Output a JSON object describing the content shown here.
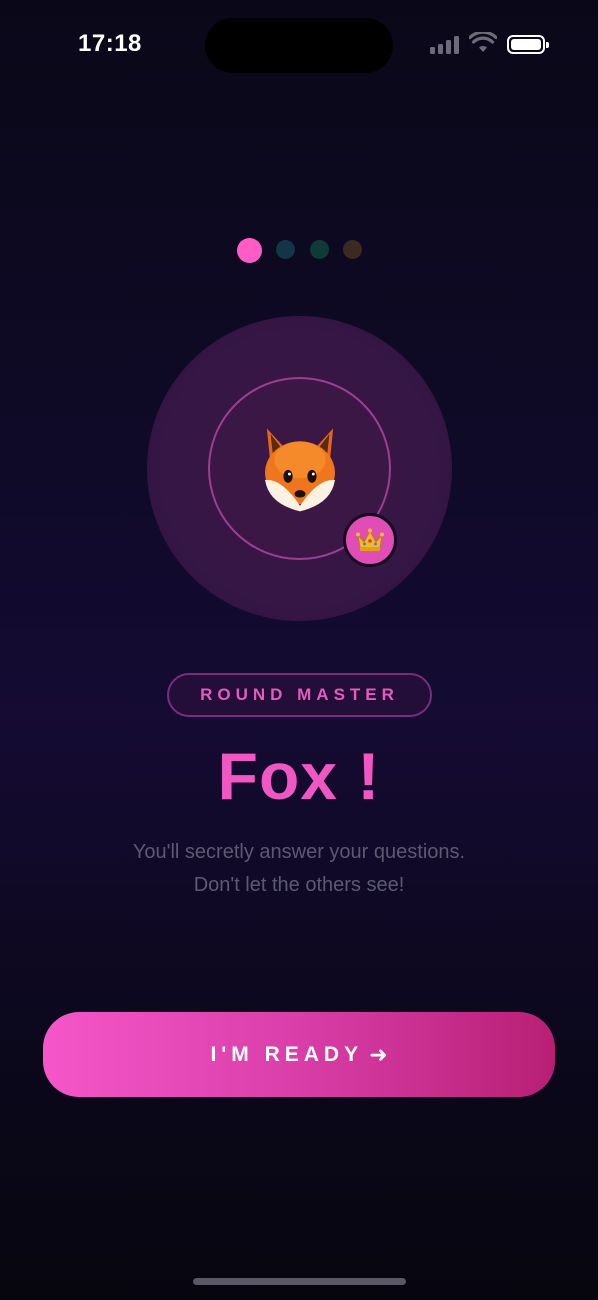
{
  "status_bar": {
    "time": "17:18",
    "signal_icon": "cellular-signal-icon",
    "wifi_icon": "wifi-icon",
    "battery_icon": "battery-icon"
  },
  "progress_dots": [
    {
      "state": "active",
      "color": "#ff5cc8"
    },
    {
      "state": "inactive",
      "color": "#123548"
    },
    {
      "state": "inactive",
      "color": "#0f3a38"
    },
    {
      "state": "inactive",
      "color": "#3a2a20"
    }
  ],
  "player": {
    "avatar_icon": "fox-emoji-icon",
    "badge_icon": "crown-icon",
    "role_label": "ROUND MASTER",
    "name_text": "Fox !",
    "instructions": [
      "You'll secretly answer your questions.",
      "Don't let the others see!"
    ]
  },
  "cta": {
    "label": "I'M READY",
    "arrow_icon": "arrow-right-icon",
    "arrow_glyph": "➜"
  },
  "colors": {
    "accent": "#f057c3",
    "muted_text": "#5c5a73"
  }
}
